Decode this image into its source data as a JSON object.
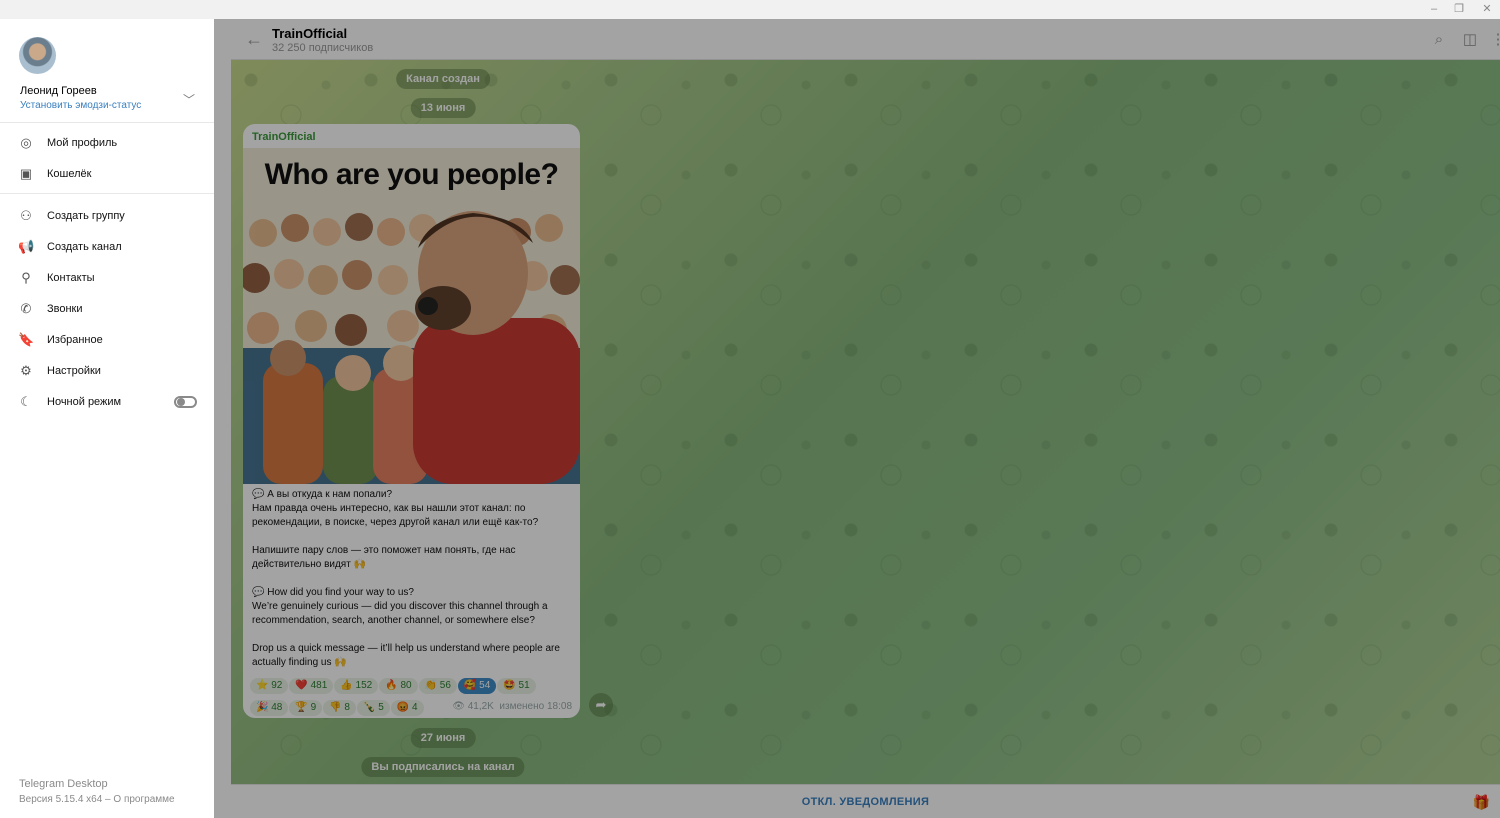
{
  "window": {
    "minimize": "–",
    "restore": "❐",
    "close": "✕"
  },
  "channel": {
    "title": "TrainOfficial",
    "subscribers": "32 250 подписчиков"
  },
  "service": {
    "created": "Канал создан",
    "date1": "13 июня",
    "date2": "27 июня",
    "subscribed": "Вы подписались на канал"
  },
  "message": {
    "author": "TrainOfficial",
    "image_title": "Who are you people?",
    "paragraphs": [
      "💬 А вы откуда к нам попали?\nНам правда очень интересно, как вы нашли этот канал: по рекомендации, в поиске, через другой канал или ещё как-то?",
      "Напишите пару слов — это поможет нам понять, где нас действительно видят 🙌",
      "💬 How did you find your way to us?\nWe’re genuinely curious — did you discover this channel through a recommendation, search, another channel, or somewhere else?",
      "Drop us a quick message — it’ll help us understand where people are actually finding us 🙌"
    ],
    "reactions": [
      {
        "emoji": "⭐",
        "count": "92"
      },
      {
        "emoji": "❤️",
        "count": "481"
      },
      {
        "emoji": "👍",
        "count": "152"
      },
      {
        "emoji": "🔥",
        "count": "80"
      },
      {
        "emoji": "👏",
        "count": "56"
      },
      {
        "emoji": "🥰",
        "count": "54",
        "active": true
      },
      {
        "emoji": "🤩",
        "count": "51"
      },
      {
        "emoji": "🎉",
        "count": "48"
      },
      {
        "emoji": "🏆",
        "count": "9"
      },
      {
        "emoji": "👎",
        "count": "8"
      },
      {
        "emoji": "🍾",
        "count": "5"
      },
      {
        "emoji": "😡",
        "count": "4"
      }
    ],
    "views": "41,2K",
    "edited": "изменено 18:08"
  },
  "bottom": {
    "mute_label": "ОТКЛ. УВЕДОМЛЕНИЯ"
  },
  "drawer": {
    "user_name": "Леонид Гореев",
    "status_link": "Установить эмодзи-статус",
    "menu": [
      {
        "icon": "◎",
        "label": "Мой профиль"
      },
      {
        "icon": "▣",
        "label": "Кошелёк"
      },
      {
        "icon": "⚇",
        "label": "Создать группу"
      },
      {
        "icon": "📢",
        "label": "Создать канал"
      },
      {
        "icon": "⚲",
        "label": "Контакты"
      },
      {
        "icon": "✆",
        "label": "Звонки"
      },
      {
        "icon": "🔖",
        "label": "Избранное"
      },
      {
        "icon": "⚙",
        "label": "Настройки"
      },
      {
        "icon": "☾",
        "label": "Ночной режим"
      }
    ],
    "app_name": "Telegram Desktop",
    "app_version": "Версия 5.15.4 x64 – О программе"
  },
  "colors": {
    "accent": "#3a80c0",
    "author": "#3a9a3a"
  }
}
